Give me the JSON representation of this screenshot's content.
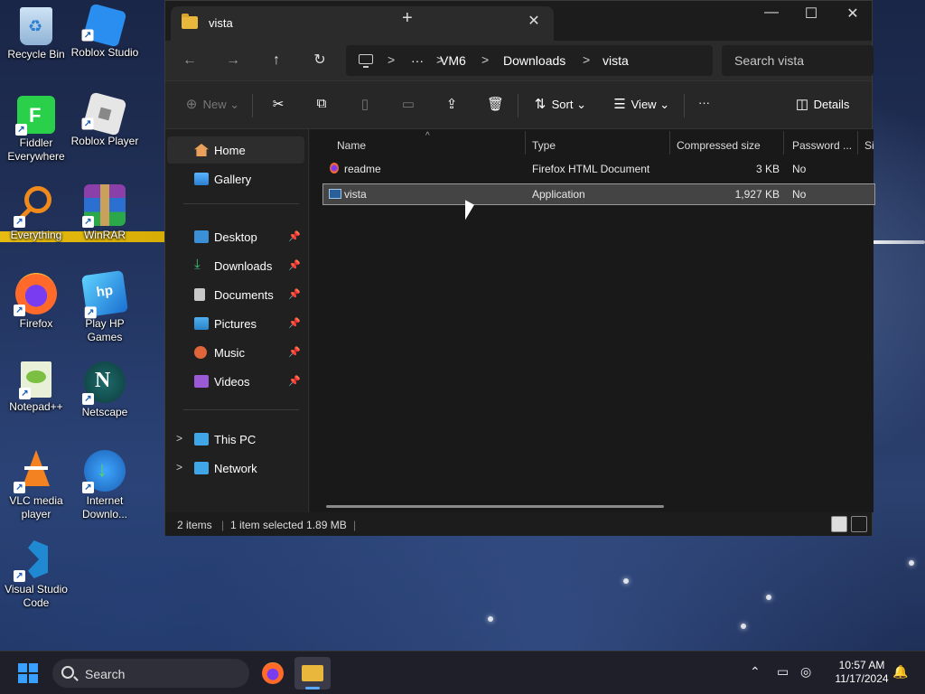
{
  "desktop": {
    "icons": [
      {
        "label": "Recycle Bin",
        "icon": "recycle-bin-icon"
      },
      {
        "label": "Roblox Studio",
        "icon": "roblox-studio-icon"
      },
      {
        "label": "Fiddler Everywhere",
        "icon": "fiddler-icon"
      },
      {
        "label": "Roblox Player",
        "icon": "roblox-player-icon"
      },
      {
        "label": "Everything",
        "icon": "everything-icon"
      },
      {
        "label": "WinRAR",
        "icon": "winrar-icon"
      },
      {
        "label": "Firefox",
        "icon": "firefox-icon"
      },
      {
        "label": "Play HP Games",
        "icon": "hp-games-icon"
      },
      {
        "label": "Notepad++",
        "icon": "notepadpp-icon"
      },
      {
        "label": "Netscape",
        "icon": "netscape-icon"
      },
      {
        "label": "VLC media player",
        "icon": "vlc-icon"
      },
      {
        "label": "Internet Downlo...",
        "icon": "idm-icon"
      },
      {
        "label": "Visual Studio Code",
        "icon": "vscode-icon"
      }
    ]
  },
  "window": {
    "tab_title": "vista",
    "new_tab_symbol": "+",
    "tab_close_symbol": "✕",
    "controls": {
      "minimize": "—",
      "maximize": "☐",
      "close": "✕"
    },
    "nav": {
      "back": "←",
      "forward": "→",
      "up": "↑",
      "refresh": "↻"
    },
    "breadcrumb": {
      "overflow": "···",
      "items": [
        "VM6",
        "Downloads",
        "vista"
      ],
      "separator": ">"
    },
    "search_placeholder": "Search vista",
    "toolbar": {
      "new_label": "New",
      "sort_label": "Sort",
      "view_label": "View",
      "more_label": "···",
      "details_label": "Details"
    },
    "navpane": {
      "top": [
        {
          "label": "Home",
          "selected": true,
          "icon": "home-icon"
        },
        {
          "label": "Gallery",
          "icon": "gallery-icon"
        }
      ],
      "quick": [
        {
          "label": "Desktop",
          "icon": "desktop-folder-icon"
        },
        {
          "label": "Downloads",
          "icon": "downloads-icon"
        },
        {
          "label": "Documents",
          "icon": "documents-icon"
        },
        {
          "label": "Pictures",
          "icon": "pictures-icon"
        },
        {
          "label": "Music",
          "icon": "music-icon"
        },
        {
          "label": "Videos",
          "icon": "videos-icon"
        }
      ],
      "tree": [
        {
          "label": "This PC",
          "icon": "this-pc-icon"
        },
        {
          "label": "Network",
          "icon": "network-icon"
        }
      ]
    },
    "columns": [
      "Name",
      "Type",
      "Compressed size",
      "Password ...",
      "Si"
    ],
    "files": [
      {
        "name": "readme",
        "type": "Firefox HTML Document",
        "size": "3 KB",
        "password": "No",
        "icon": "html-file-icon"
      },
      {
        "name": "vista",
        "type": "Application",
        "size": "1,927 KB",
        "password": "No",
        "icon": "application-icon",
        "selected": true
      }
    ],
    "status": {
      "count": "2 items",
      "selection": "1 item selected  1.89 MB"
    }
  },
  "taskbar": {
    "search_label": "Search",
    "time": "10:57 AM",
    "date": "11/17/2024"
  },
  "colors": {
    "accent": "#3aa0ff",
    "folder": "#e8b73c",
    "window_bg": "#202020"
  }
}
